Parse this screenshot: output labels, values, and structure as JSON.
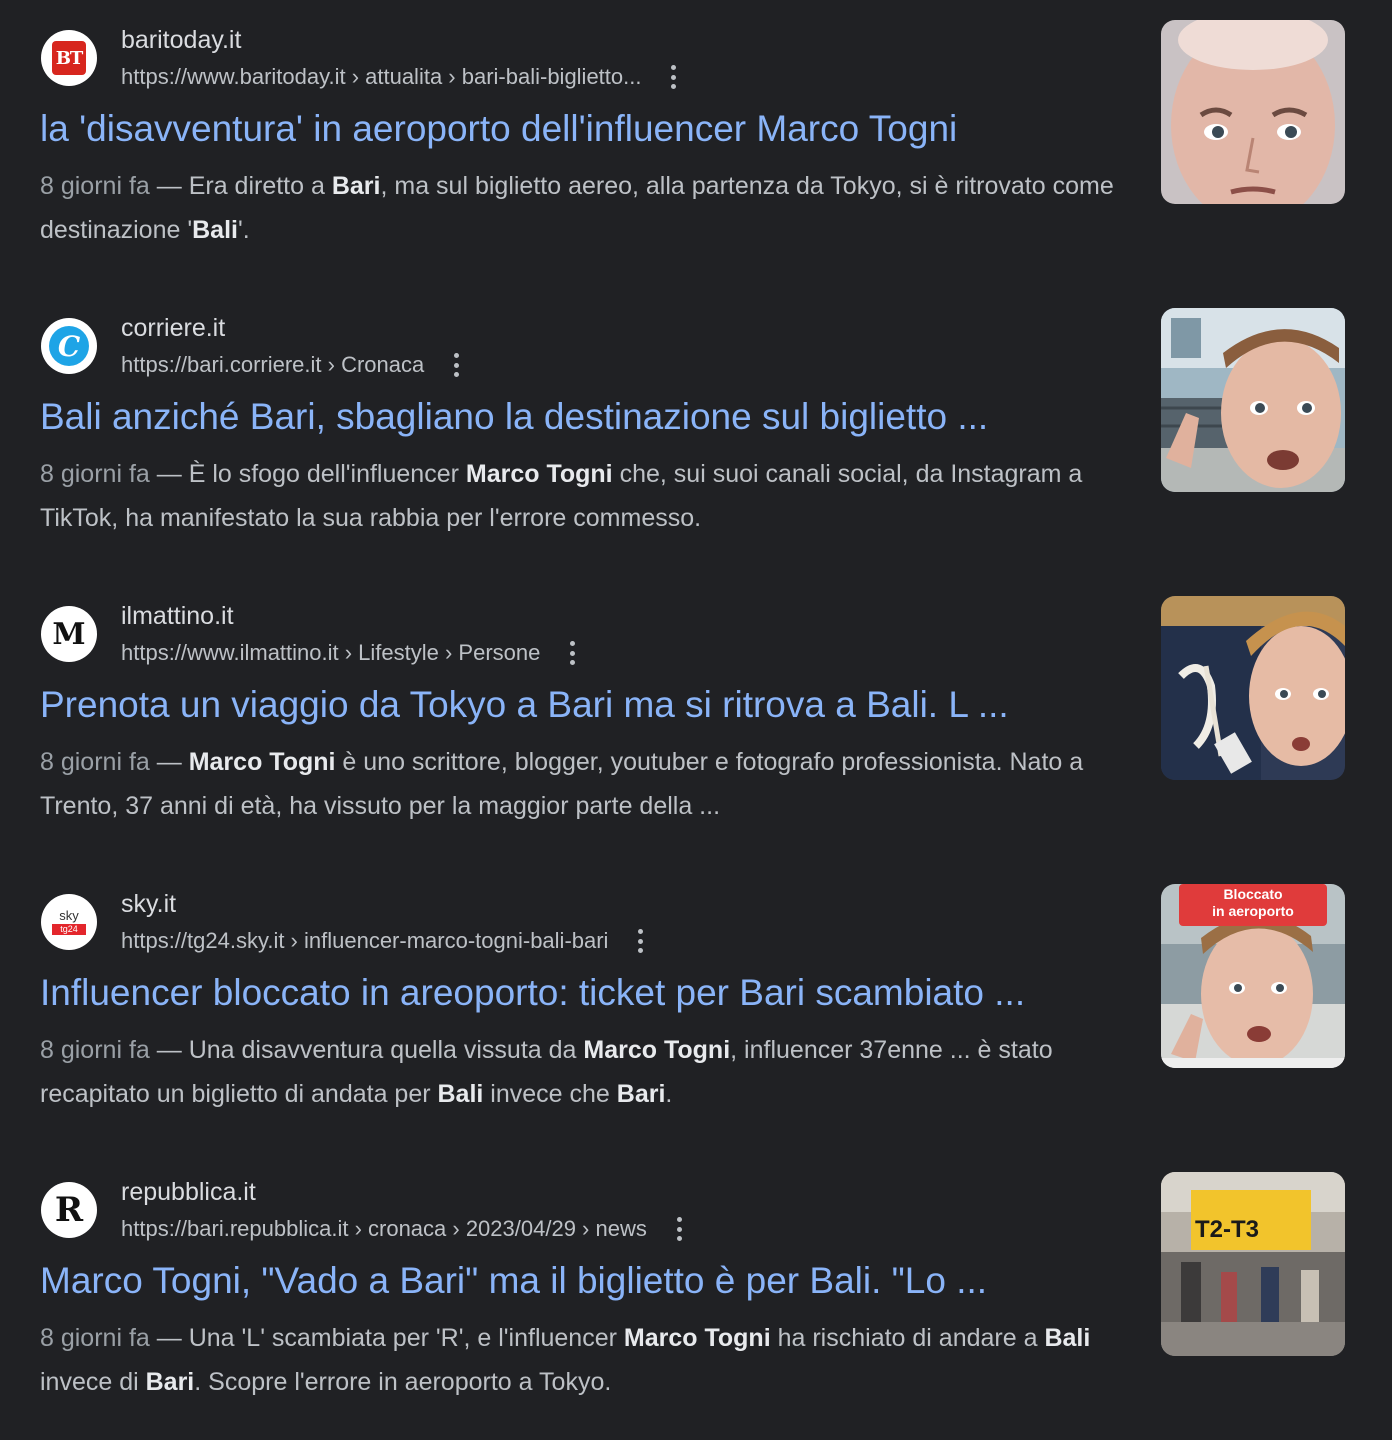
{
  "results": [
    {
      "site_name": "baritoday.it",
      "url": "https://www.baritoday.it › attualita › bari-bali-biglietto...",
      "favicon_text": "BT",
      "favicon_icon": "baritoday-logo-icon",
      "title": "la 'disavventura' in aeroporto dell'influencer Marco Togni",
      "date": "8 giorni fa",
      "snippet_parts": [
        "Era diretto a ",
        "Bari",
        ", ma sul biglietto aereo, alla partenza da Tokyo, si è ritrovato come destinazione '",
        "Bali",
        "'."
      ]
    },
    {
      "site_name": "corriere.it",
      "url": "https://bari.corriere.it › Cronaca",
      "favicon_text": "C",
      "favicon_icon": "corriere-logo-icon",
      "title": "Bali anziché Bari, sbagliano la destinazione sul biglietto ...",
      "date": "8 giorni fa",
      "snippet_parts": [
        "È lo sfogo dell'influencer ",
        "Marco Togni",
        " che, sui suoi canali social, da Instagram a TikTok, ha manifestato la sua rabbia per l'errore commesso.",
        "",
        ""
      ]
    },
    {
      "site_name": "ilmattino.it",
      "url": "https://www.ilmattino.it › Lifestyle › Persone",
      "favicon_text": "M",
      "favicon_icon": "ilmattino-logo-icon",
      "title": "Prenota un viaggio da Tokyo a Bari ma si ritrova a Bali. L ...",
      "date": "8 giorni fa",
      "snippet_parts": [
        "",
        "Marco Togni",
        " è uno scrittore, blogger, youtuber e fotografo professionista. Nato a Trento, 37 anni di età, ha vissuto per la maggior parte della ...",
        "",
        ""
      ]
    },
    {
      "site_name": "sky.it",
      "url": "https://tg24.sky.it › influencer-marco-togni-bali-bari",
      "favicon_text": "sky",
      "favicon_subtext": "tg24",
      "favicon_icon": "skytg24-logo-icon",
      "title": "Influencer bloccato in areoporto: ticket per Bari scambiato ...",
      "date": "8 giorni fa",
      "snippet_parts": [
        "Una disavventura quella vissuta da ",
        "Marco Togni",
        ", influencer 37enne ... è stato recapitato un biglietto di andata per ",
        "Bali",
        " invece che ",
        "Bari",
        "."
      ],
      "thumb_caption_line1": "Bloccato",
      "thumb_caption_line2": "in aeroporto"
    },
    {
      "site_name": "repubblica.it",
      "url": "https://bari.repubblica.it › cronaca › 2023/04/29 › news",
      "favicon_text": "R",
      "favicon_icon": "repubblica-logo-icon",
      "title": "Marco Togni, \"Vado a Bari\" ma il biglietto è per Bali. \"Lo ...",
      "date": "8 giorni fa",
      "snippet_parts": [
        "Una 'L' scambiata per 'R', e l'influencer ",
        "Marco Togni",
        " ha rischiato di andare a ",
        "Bali",
        " invece di ",
        "Bari",
        ". Scopre l'errore in aeroporto a Tokyo."
      ],
      "thumb_sign": "T2-T3"
    }
  ],
  "separator": " — ",
  "colors": {
    "background": "#202124",
    "title_link": "#8ab4f8",
    "text": "#bdc1c6"
  }
}
